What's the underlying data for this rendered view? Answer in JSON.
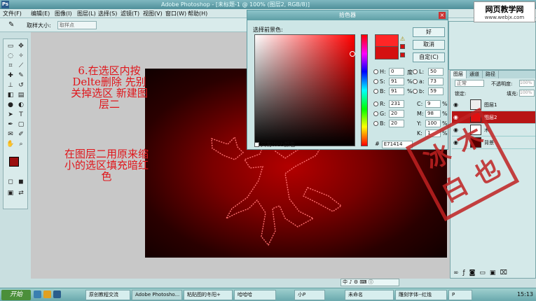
{
  "titlebar": {
    "app_title": "Adobe Photoshop - [未标题-1 @ 100% (图层2, RGB/8)]",
    "logo": "Ps"
  },
  "site_watermark": {
    "line1": "网页教学网",
    "line2": "www.webjx.com"
  },
  "menu": [
    "文件(F)",
    "编辑(E)",
    "图像(I)",
    "图层(L)",
    "选择(S)",
    "滤镜(T)",
    "视图(V)",
    "窗口(W)",
    "帮助(H)"
  ],
  "options": {
    "label": "取样大小:",
    "value": "取样点"
  },
  "instruction": {
    "step": "6.在选区内按",
    "line2": "Delte删除 先别",
    "line3": "关掉选区 新建图",
    "line4": "层二",
    "para2_l1": "在图层二用原来缩",
    "para2_l2": "小的选区填充暗红",
    "para2_l3": "色"
  },
  "picker": {
    "title": "拾色器",
    "subtitle": "选择前景色:",
    "ok": "好",
    "cancel": "取消",
    "swatches": "自定(C)",
    "fields": {
      "H": "0",
      "S": "91",
      "B": "91",
      "R": "231",
      "G": "20",
      "Bv": "20",
      "L": "50",
      "a": "73",
      "bv": "59",
      "C": "9",
      "M": "98",
      "Y": "100",
      "K": "1"
    },
    "deg": "度",
    "pct": "%",
    "web_only": "只有Web颜色",
    "hex_label": "#",
    "hex": "E71414",
    "new_color": "#ff2626",
    "current_color": "#d41010"
  },
  "layers": {
    "tabs": [
      "图层",
      "通道",
      "路径"
    ],
    "blend": "正常",
    "opacity_label": "不透明度:",
    "opacity": "100%",
    "lock_label": "锁定:",
    "fill_label": "填充:",
    "fill": "100%",
    "items": [
      {
        "name": "图层1",
        "active": false
      },
      {
        "name": "图层2",
        "active": true
      },
      {
        "name": "木",
        "active": false
      },
      {
        "name": "背景",
        "active": false
      }
    ]
  },
  "stamp": {
    "chars": [
      "冰",
      "木",
      "白",
      "也"
    ]
  },
  "ime": "中 ♪ ⚙ ⌨ ⓘ",
  "taskbar": {
    "start": "开始",
    "items": [
      "原创教程交流",
      "Adobe Photosho...",
      "粘贴图的冬阳+",
      "哈哈哈",
      "小P",
      "未命名",
      "雕刻字体--红烛",
      "P"
    ],
    "clock": "15:13"
  },
  "colors": {
    "accent": "#e0161b",
    "fg_swatch": "#9a1010",
    "bg_swatch": "#ffffff"
  }
}
